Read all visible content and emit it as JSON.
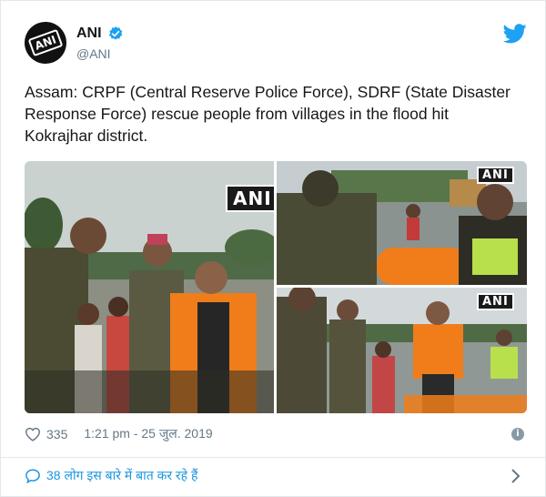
{
  "account": {
    "avatar_text": "ANI",
    "name": "ANI",
    "handle": "@ANI"
  },
  "tweet": {
    "text": "Assam: CRPF (Central Reserve Police Force), SDRF (State Disaster Response Force) rescue people from villages in the flood hit Kokrajhar district."
  },
  "media": {
    "watermarks": [
      "ANI",
      "ANI",
      "ANI"
    ]
  },
  "footer": {
    "like_count": "335",
    "timestamp": "1:21 pm - 25 जुल. 2019",
    "conversation": "38 लोग इस बारे में बात कर रहे हैं"
  },
  "icons": {
    "verified": "verified-badge-icon",
    "brand": "twitter-bird-icon",
    "like": "heart-icon",
    "info": "info-icon",
    "reply": "speech-bubble-icon",
    "next": "chevron-right-icon"
  },
  "colors": {
    "brand_blue": "#1da1f2",
    "link_blue": "#1b95e0",
    "meta_gray": "#657786",
    "life_jacket_orange": "#f07d1a"
  }
}
